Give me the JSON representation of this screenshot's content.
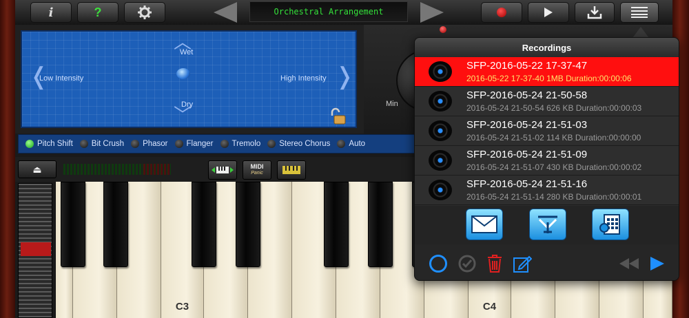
{
  "toolbar": {
    "info_label": "i",
    "help_label": "?",
    "settings_icon": "gear-icon",
    "prev_icon": "left-arrow-icon",
    "preset_name": "Orchestral Arrangement",
    "next_icon": "right-arrow-icon",
    "record_icon": "record-icon",
    "play_icon": "play-icon",
    "import_icon": "download-tray-icon",
    "list_icon": "list-icon"
  },
  "pad": {
    "top_label": "Wet",
    "bottom_label": "Dry",
    "left_label": "Low Intensity",
    "right_label": "High Intensity",
    "lock_icon": "unlocked-padlock-icon"
  },
  "knob": {
    "min_label": "Min"
  },
  "effects": [
    {
      "label": "Pitch Shift",
      "on": true
    },
    {
      "label": "Bit Crush",
      "on": false
    },
    {
      "label": "Phasor",
      "on": false
    },
    {
      "label": "Flanger",
      "on": false
    },
    {
      "label": "Tremolo",
      "on": false
    },
    {
      "label": "Stereo Chorus",
      "on": false
    },
    {
      "label": "Auto",
      "on": false
    }
  ],
  "keyboard_controls": {
    "eject_icon": "eject-icon",
    "midi_label": "MIDI",
    "midi_sub": "Panic"
  },
  "piano": {
    "labels": [
      "C3",
      "C4"
    ]
  },
  "recordings": {
    "title": "Recordings",
    "items": [
      {
        "name": "SFP-2016-05-22 17-37-47",
        "meta": "2016-05-22 17-37-40  1MB  Duration:00:00:06",
        "selected": true
      },
      {
        "name": "SFP-2016-05-24 21-50-58",
        "meta": "2016-05-24 21-50-54  626 KB  Duration:00:00:03",
        "selected": false
      },
      {
        "name": "SFP-2016-05-24 21-51-03",
        "meta": "2016-05-24 21-51-02  114 KB  Duration:00:00:00",
        "selected": false
      },
      {
        "name": "SFP-2016-05-24 21-51-09",
        "meta": "2016-05-24 21-51-07  430 KB  Duration:00:00:02",
        "selected": false
      },
      {
        "name": "SFP-2016-05-24 21-51-16",
        "meta": "2016-05-24 21-51-14  280 KB  Duration:00:00:01",
        "selected": false
      }
    ],
    "share_icons": [
      "envelope-icon",
      "itunes-share-icon",
      "audio-file-icon"
    ],
    "footer_icons": [
      "select-circle-icon",
      "checkmark-icon",
      "trash-icon",
      "edit-icon",
      "rewind-icon",
      "play-icon"
    ]
  },
  "colors": {
    "accent_green": "#35e23b",
    "pad_blue": "#1d5fb8",
    "selected_row": "#ff0f0f",
    "selected_meta": "#ffe36a",
    "footer_blue": "#1f8fff",
    "trash_red": "#e02020"
  }
}
